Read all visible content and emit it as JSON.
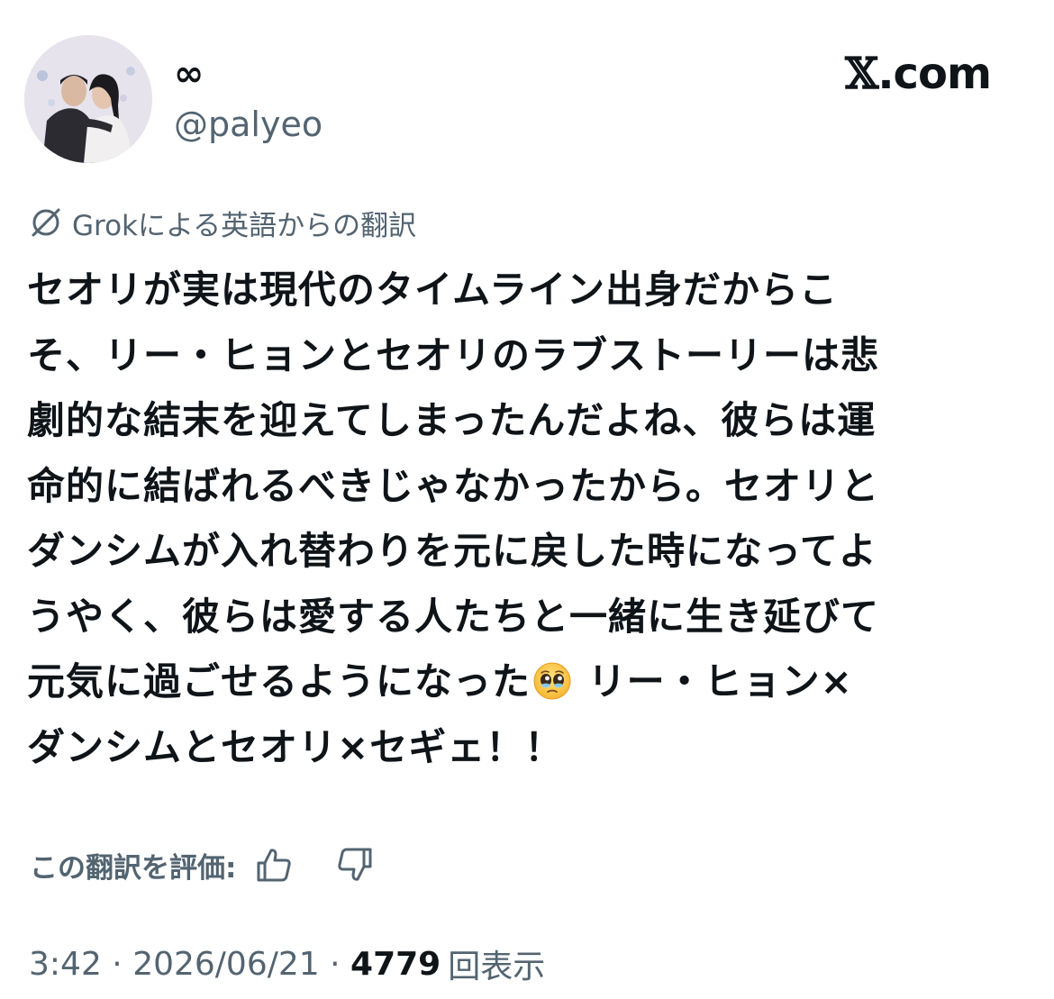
{
  "header": {
    "display_name": "∞",
    "handle": "@palyeo",
    "brand": {
      "mark": "𝕏",
      "suffix": ".com"
    }
  },
  "translation": {
    "label": "Grokによる英語からの翻訳",
    "icon": "grok-icon"
  },
  "tweet": {
    "lines": [
      "セオリが実は現代のタイムライン出身だからこ",
      "そ、リー・ヒョンとセオリのラブストーリーは悲",
      "劇的な結末を迎えてしまったんだよね、彼らは運",
      "命的に結ばれるべきじゃなかったから。セオリと",
      "ダンシムが入れ替わりを元に戻した時になってよ",
      "うやく、彼らは愛する人たちと一緒に生き延びて"
    ],
    "line7_before_emoji": "元気に過ごせるようになった",
    "emoji": "pleading-face-emoji",
    "line7_after_emoji": " リー・ヒョン×",
    "line8": "ダンシムとセオリ×セギェ！！"
  },
  "rating": {
    "label": "この翻訳を評価:",
    "thumbs_up_icon": "thumbs-up-icon",
    "thumbs_down_icon": "thumbs-down-icon"
  },
  "meta": {
    "time": "3:42",
    "separator": " · ",
    "date": "2026/06/21",
    "views_count": "4779",
    "views_label": "回表示"
  }
}
